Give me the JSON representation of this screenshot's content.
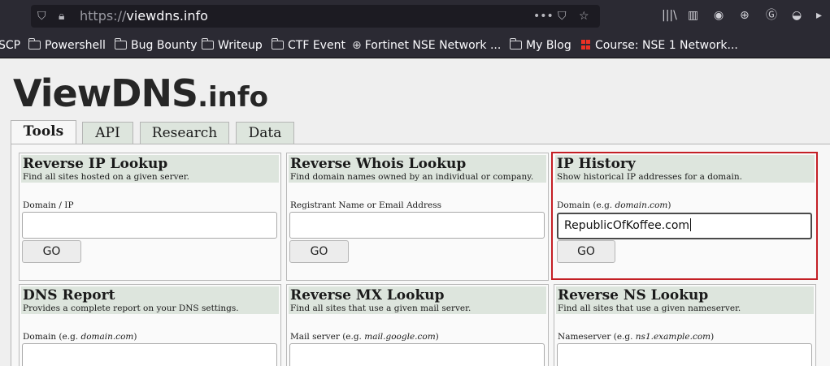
{
  "browser": {
    "url_scheme": "https://",
    "url_host": "viewdns.info",
    "bookmarks": [
      {
        "label": "SCP",
        "icon": "none"
      },
      {
        "label": "Powershell",
        "icon": "folder-icon"
      },
      {
        "label": "Bug Bounty",
        "icon": "folder-icon"
      },
      {
        "label": "Writeup",
        "icon": "folder-icon"
      },
      {
        "label": "CTF Event",
        "icon": "folder-icon"
      },
      {
        "label": "Fortinet NSE Network ...",
        "icon": "globe-icon"
      },
      {
        "label": "My Blog",
        "icon": "folder-icon"
      },
      {
        "label": "Course: NSE 1 Network...",
        "icon": "fortinet-icon"
      }
    ]
  },
  "site": {
    "logo_main": "ViewDNS",
    "logo_suffix": ".info",
    "tabs": [
      "Tools",
      "API",
      "Research",
      "Data"
    ],
    "active_tab": "Tools"
  },
  "tools": [
    {
      "title": "Reverse IP Lookup",
      "desc": "Find all sites hosted on a given server.",
      "label": "Domain / IP",
      "example": "",
      "value": "",
      "button": "GO"
    },
    {
      "title": "Reverse Whois Lookup",
      "desc": "Find domain names owned by an individual or company.",
      "label": "Registrant Name or Email Address",
      "example": "",
      "value": "",
      "button": "GO"
    },
    {
      "title": "IP History",
      "desc": "Show historical IP addresses for a domain.",
      "label": "Domain (e.g. ",
      "example": "domain.com",
      "value": "RepublicOfKoffee.com",
      "button": "GO"
    },
    {
      "title": "DNS Report",
      "desc": "Provides a complete report on your DNS settings.",
      "label": "Domain (e.g. ",
      "example": "domain.com",
      "value": "",
      "button": "GO"
    },
    {
      "title": "Reverse MX Lookup",
      "desc": "Find all sites that use a given mail server.",
      "label": "Mail server (e.g. ",
      "example": "mail.google.com",
      "value": "",
      "button": "GO"
    },
    {
      "title": "Reverse NS Lookup",
      "desc": "Find all sites that use a given nameserver.",
      "label": "Nameserver (e.g. ",
      "example": "ns1.example.com",
      "value": "",
      "button": "GO"
    }
  ],
  "colors": {
    "chrome_bg": "#2b2a33",
    "panel_header": "#dde5dd",
    "highlight_border": "#c41f25"
  }
}
